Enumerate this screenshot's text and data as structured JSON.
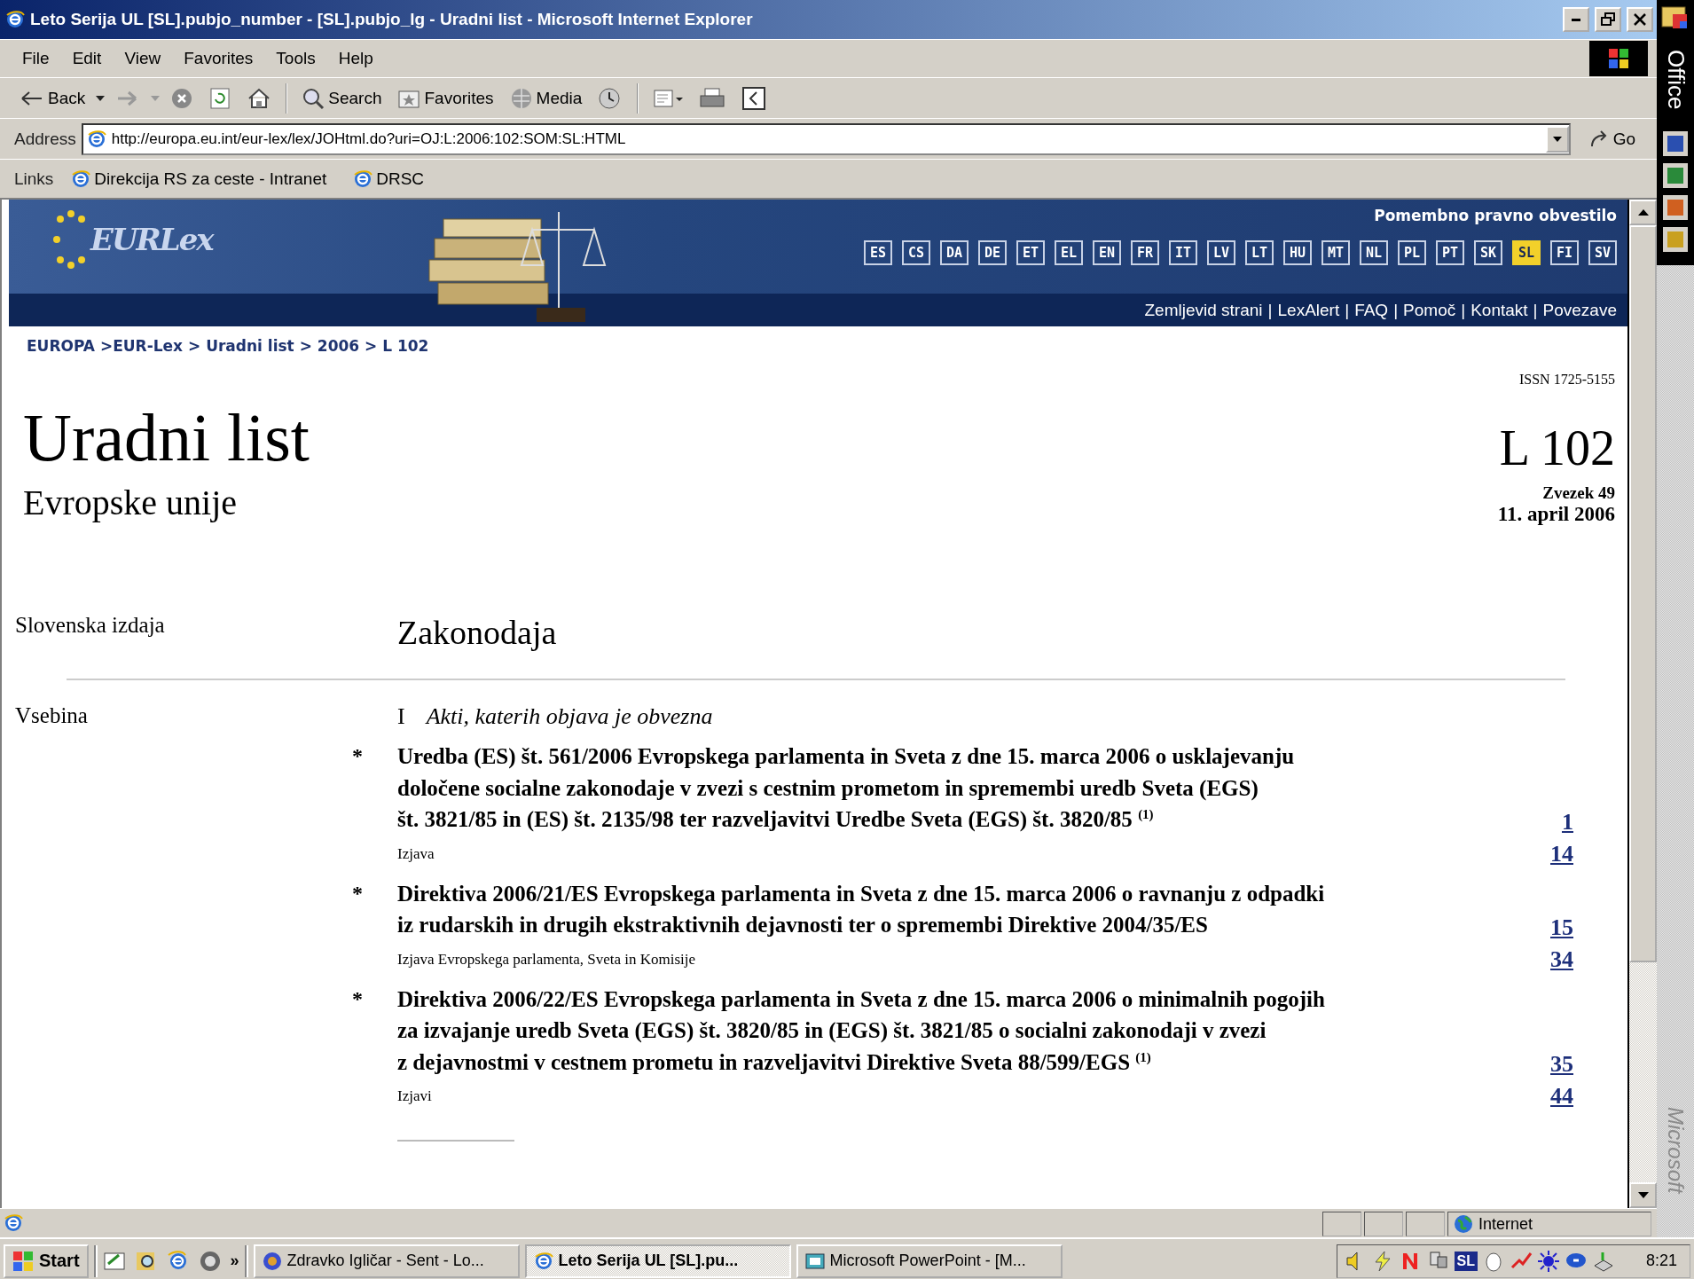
{
  "window": {
    "title": "Leto Serija UL [SL].pubjo_number - [SL].pubjo_lg - Uradni list - Microsoft Internet Explorer"
  },
  "menu": [
    "File",
    "Edit",
    "View",
    "Favorites",
    "Tools",
    "Help"
  ],
  "toolbar": [
    {
      "kind": "back",
      "label": "Back"
    },
    {
      "kind": "forward"
    },
    {
      "kind": "stop"
    },
    {
      "kind": "refresh"
    },
    {
      "kind": "home"
    },
    {
      "kind": "search",
      "label": "Search"
    },
    {
      "kind": "favorites",
      "label": "Favorites"
    },
    {
      "kind": "media",
      "label": "Media"
    },
    {
      "kind": "history"
    },
    {
      "kind": "mail"
    },
    {
      "kind": "print"
    },
    {
      "kind": "edit"
    }
  ],
  "address": {
    "label": "Address",
    "value": "http://europa.eu.int/eur-lex/lex/JOHtml.do?uri=OJ:L:2006:102:SOM:SL:HTML",
    "go": "Go"
  },
  "links": {
    "label": "Links",
    "items": [
      "Direkcija RS za ceste - Intranet",
      "DRSC"
    ]
  },
  "banner": {
    "logo": "EURLex",
    "notice": "Pomembno pravno obvestilo",
    "languages": [
      {
        "code": "ES",
        "selected": false
      },
      {
        "code": "CS",
        "selected": false
      },
      {
        "code": "DA",
        "selected": false
      },
      {
        "code": "DE",
        "selected": false
      },
      {
        "code": "ET",
        "selected": false
      },
      {
        "code": "EL",
        "selected": false
      },
      {
        "code": "EN",
        "selected": false
      },
      {
        "code": "FR",
        "selected": false
      },
      {
        "code": "IT",
        "selected": false
      },
      {
        "code": "LV",
        "selected": false
      },
      {
        "code": "LT",
        "selected": false
      },
      {
        "code": "HU",
        "selected": false
      },
      {
        "code": "MT",
        "selected": false
      },
      {
        "code": "NL",
        "selected": false
      },
      {
        "code": "PL",
        "selected": false
      },
      {
        "code": "PT",
        "selected": false
      },
      {
        "code": "SK",
        "selected": false
      },
      {
        "code": "SL",
        "selected": true
      },
      {
        "code": "FI",
        "selected": false
      },
      {
        "code": "SV",
        "selected": false
      }
    ],
    "separator": "|",
    "nav": [
      "Zemljevid strani",
      "LexAlert",
      "FAQ",
      "Pomoč",
      "Kontakt",
      "Povezave"
    ]
  },
  "breadcrumb": "EUROPA >EUR-Lex > Uradni list > 2006 > L 102",
  "header": {
    "issn": "ISSN 1725-5155",
    "title": "Uradni list",
    "subtitle": "Evropske unije",
    "number": "L 102",
    "volume": "Zvezek 49",
    "date": "11. april 2006"
  },
  "edition": {
    "label": "Slovenska izdaja",
    "section": "Zakonodaja"
  },
  "contents": {
    "label": "Vsebina",
    "part_numeral": "I",
    "part_title": "Akti, katerih objava je obvezna",
    "entries": [
      {
        "kind": "act",
        "marker": "*",
        "lines": [
          "Uredba (ES) št. 561/2006 Evropskega parlamenta in Sveta z dne 15. marca 2006 o usklajevanju",
          "določene socialne zakonodaje v zvezi s cestnim prometom in spremembi uredb Sveta (EGS)",
          "št. 3821/85 in (ES) št. 2135/98 ter razveljavitvi Uredbe Sveta (EGS) št. 3820/85 $^{(1)}$"
        ],
        "page": "1"
      },
      {
        "kind": "note",
        "text": "Izjava",
        "page": "14"
      },
      {
        "kind": "act",
        "marker": "*",
        "lines": [
          "Direktiva 2006/21/ES Evropskega parlamenta in Sveta z dne 15. marca 2006 o ravnanju z odpadki",
          "iz rudarskih in drugih ekstraktivnih dejavnosti ter o spremembi Direktive 2004/35/ES"
        ],
        "page": "15"
      },
      {
        "kind": "note",
        "text": "Izjava Evropskega parlamenta, Sveta in Komisije",
        "page": "34"
      },
      {
        "kind": "act",
        "marker": "*",
        "lines": [
          "Direktiva 2006/22/ES Evropskega parlamenta in Sveta z dne 15. marca 2006 o minimalnih pogojih",
          "za izvajanje uredb Sveta (EGS) št. 3820/85 in (EGS) št. 3821/85 o socialni zakonodaji v zvezi",
          "z dejavnostmi v cestnem prometu in razveljavitvi Direktive Sveta 88/599/EGS $^{(1)}$"
        ],
        "page": "35"
      },
      {
        "kind": "note",
        "text": "Izjavi",
        "page": "44"
      }
    ]
  },
  "status": {
    "zone": "Internet"
  },
  "taskbar": {
    "start": "Start",
    "more": "»",
    "tasks": [
      {
        "label": "Zdravko Igličar - Sent - Lo...",
        "selected": false
      },
      {
        "label": "Leto Serija UL [SL].pu...",
        "selected": true
      },
      {
        "label": "Microsoft PowerPoint - [M...",
        "selected": false
      }
    ],
    "language": "SL",
    "clock": "8:21"
  },
  "office_bar": {
    "title": "Office",
    "footer": "Microsoft"
  }
}
